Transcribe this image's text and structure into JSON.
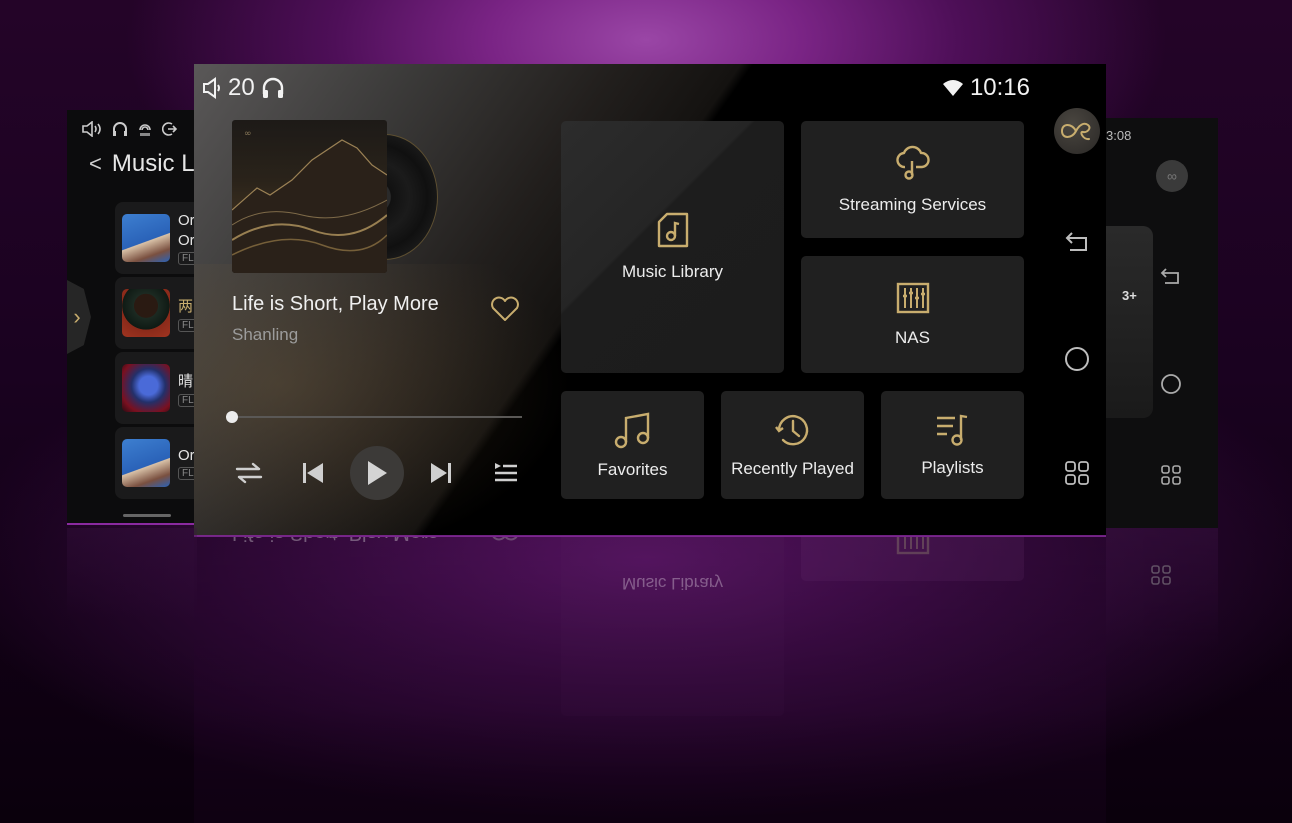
{
  "colors": {
    "accent_gold": "#c8ad6e",
    "background_purple": "#7a2485",
    "tile_bg": "#202020"
  },
  "back_left_screen": {
    "status_icons": [
      "volume-icon",
      "headphones-icon",
      "hi-res-audio-icon",
      "output-icon"
    ],
    "title": "Music L",
    "back_label": "<",
    "handle_icon": "chevron-right-icon",
    "list": [
      {
        "line1": "Or",
        "line2": "Or",
        "tag": "FL"
      },
      {
        "line1": "两",
        "line2": "",
        "tag": "FL"
      },
      {
        "line1": "晴",
        "line2": "",
        "tag": "FL"
      },
      {
        "line1": "Or",
        "line2": "",
        "tag": "FL"
      }
    ]
  },
  "back_right_screen": {
    "time": "3:08",
    "badge": "3+",
    "nav_icons": [
      "back-icon",
      "home-icon",
      "apps-icon"
    ]
  },
  "status_bar": {
    "volume": "20",
    "time": "10:16",
    "icons": [
      "volume-icon",
      "headphones-icon",
      "wifi-icon"
    ]
  },
  "now_playing": {
    "title": "Life is Short, Play More",
    "artist": "Shanling",
    "favorite": false,
    "progress": 0.0
  },
  "controls": [
    "repeat-icon",
    "previous-icon",
    "play-icon",
    "next-icon",
    "queue-icon"
  ],
  "tiles": {
    "music_library": "Music Library",
    "streaming": "Streaming Services",
    "nas": "NAS",
    "favorites": "Favorites",
    "recently_played": "Recently Played",
    "playlists": "Playlists"
  },
  "sidebar": {
    "logo": "Shanling",
    "nav_icons": [
      "back-icon",
      "home-icon",
      "apps-icon"
    ]
  }
}
